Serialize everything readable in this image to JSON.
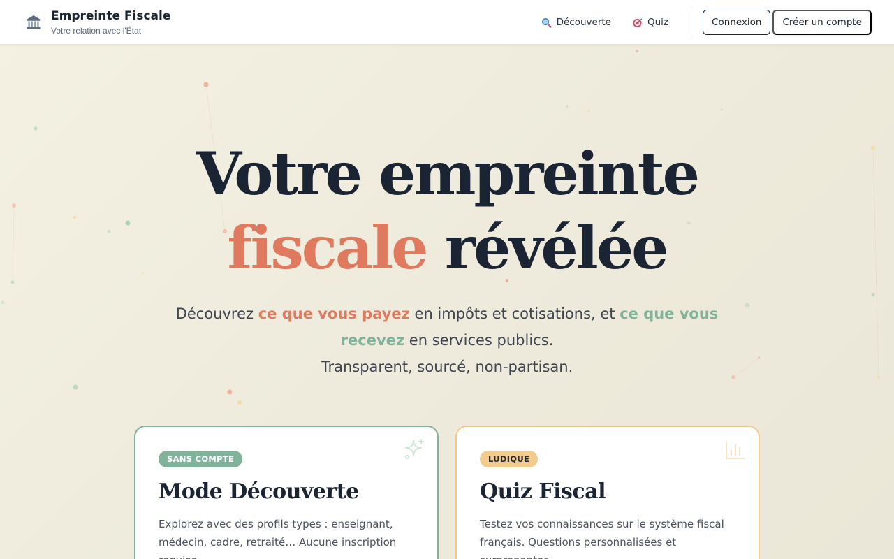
{
  "header": {
    "brand_name": "Empreinte Fiscale",
    "brand_subtitle": "Votre relation avec l'État",
    "brand_icon": "bank-building-icon",
    "nav": [
      {
        "label": "Découverte",
        "icon": "magnifier-icon"
      },
      {
        "label": "Quiz",
        "icon": "target-icon"
      }
    ],
    "login_label": "Connexion",
    "register_label": "Créer un compte"
  },
  "hero": {
    "title_line1": "Votre empreinte",
    "title_accent": "fiscale",
    "title_rest": "révélée",
    "desc_prefix": "Découvrez ",
    "desc_pay": "ce que vous payez",
    "desc_middle": " en impôts et cotisations, et ",
    "desc_get": "ce que vous recevez",
    "desc_suffix": " en services publics.",
    "desc_line3": "Transparent, sourcé, non-partisan."
  },
  "cards": [
    {
      "badge": "SANS COMPTE",
      "title": "Mode Découverte",
      "text": "Explorez avec des profils types : enseignant, médecin, cadre, retraité… Aucune inscription requise.",
      "icon": "sparkles-icon"
    },
    {
      "badge": "LUDIQUE",
      "title": "Quiz Fiscal",
      "text": "Testez vos connaissances sur le système fiscal français. Questions personnalisées et surprenantes.",
      "icon": "bar-chart-icon"
    }
  ],
  "colors": {
    "navy": "#1b2433",
    "coral": "#e07a5f",
    "sage": "#81b29a",
    "sand": "#f2cc8f",
    "background": "#f1eee0"
  }
}
